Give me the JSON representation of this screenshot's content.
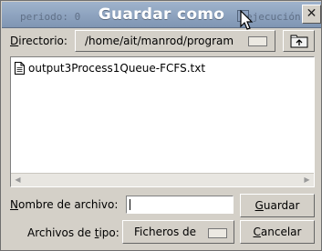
{
  "window": {
    "title": "Guardar como",
    "background_text_left": "periodo: 0",
    "background_text_right": "ejecución"
  },
  "directory": {
    "label_mnemonic": "D",
    "label_rest": "irectorio:",
    "current": "/home/ait/manrod/program"
  },
  "files": [
    {
      "name": "output3Process1Queue-FCFS.txt"
    }
  ],
  "filename": {
    "label_mnemonic": "N",
    "label_rest": "ombre de archivo:",
    "value": ""
  },
  "filetype": {
    "label_prefix": "Archivos de ",
    "label_mnemonic": "t",
    "label_suffix": "ipo:",
    "selected": "Ficheros de"
  },
  "buttons": {
    "save_mnemonic": "G",
    "save_rest": "uardar",
    "cancel_mnemonic": "C",
    "cancel_rest": "ancelar"
  },
  "icons": {
    "close": "close-icon",
    "up_dir": "folder-up-icon",
    "file": "text-file-icon",
    "pointer": "mouse-pointer-icon"
  },
  "colors": {
    "titlebar": "#8aa0bd",
    "dialog_bg": "#d4d0c8",
    "list_bg": "#ffffff"
  }
}
